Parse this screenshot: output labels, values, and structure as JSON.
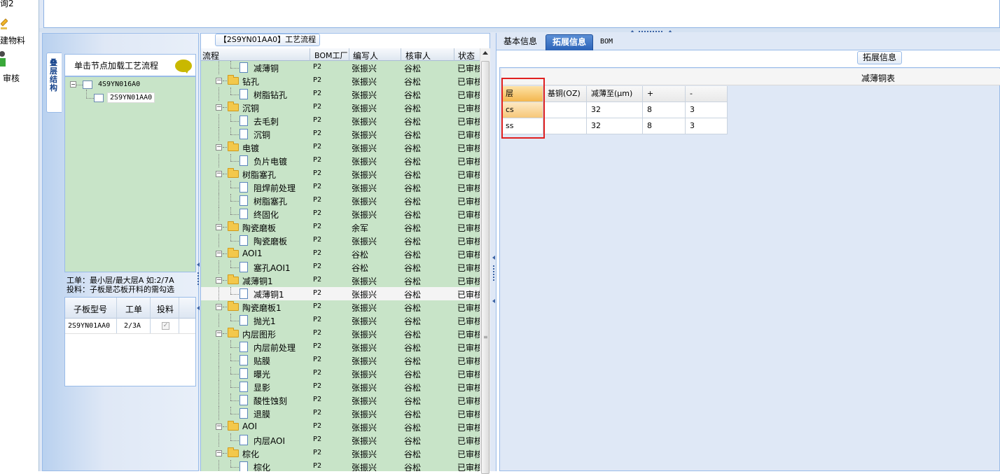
{
  "left_nav": {
    "items": [
      {
        "label": "询2"
      },
      {
        "label": "建物料"
      },
      {
        "label": "审核"
      }
    ]
  },
  "process_panel": {
    "title": "【2S9YN01AA0】工艺流程",
    "columns": [
      "流程",
      "BOM工厂",
      "编写人",
      "核审人",
      "状态"
    ],
    "rows": [
      {
        "name": "减薄铜",
        "level": 1,
        "bom": "P2",
        "author": "张振兴",
        "reviewer": "谷松",
        "status": "已审核"
      },
      {
        "name": "钻孔",
        "level": 0,
        "bom": "P2",
        "author": "张振兴",
        "reviewer": "谷松",
        "status": "已审核"
      },
      {
        "name": "树脂钻孔",
        "level": 1,
        "bom": "P2",
        "author": "张振兴",
        "reviewer": "谷松",
        "status": "已审核"
      },
      {
        "name": "沉铜",
        "level": 0,
        "bom": "P2",
        "author": "张振兴",
        "reviewer": "谷松",
        "status": "已审核"
      },
      {
        "name": "去毛刺",
        "level": 1,
        "bom": "P2",
        "author": "张振兴",
        "reviewer": "谷松",
        "status": "已审核"
      },
      {
        "name": "沉铜",
        "level": 1,
        "bom": "P2",
        "author": "张振兴",
        "reviewer": "谷松",
        "status": "已审核"
      },
      {
        "name": "电镀",
        "level": 0,
        "bom": "P2",
        "author": "张振兴",
        "reviewer": "谷松",
        "status": "已审核"
      },
      {
        "name": "负片电镀",
        "level": 1,
        "bom": "P2",
        "author": "张振兴",
        "reviewer": "谷松",
        "status": "已审核"
      },
      {
        "name": "树脂塞孔",
        "level": 0,
        "bom": "P2",
        "author": "张振兴",
        "reviewer": "谷松",
        "status": "已审核"
      },
      {
        "name": "阻焊前处理",
        "level": 1,
        "bom": "P2",
        "author": "张振兴",
        "reviewer": "谷松",
        "status": "已审核"
      },
      {
        "name": "树脂塞孔",
        "level": 1,
        "bom": "P2",
        "author": "张振兴",
        "reviewer": "谷松",
        "status": "已审核"
      },
      {
        "name": "终固化",
        "level": 1,
        "bom": "P2",
        "author": "张振兴",
        "reviewer": "谷松",
        "status": "已审核"
      },
      {
        "name": "陶瓷磨板",
        "level": 0,
        "bom": "P2",
        "author": "余军",
        "reviewer": "谷松",
        "status": "已审核"
      },
      {
        "name": "陶瓷磨板",
        "level": 1,
        "bom": "P2",
        "author": "张振兴",
        "reviewer": "谷松",
        "status": "已审核"
      },
      {
        "name": "AOI1",
        "level": 0,
        "bom": "P2",
        "author": "谷松",
        "reviewer": "谷松",
        "status": "已审核"
      },
      {
        "name": "塞孔AOI1",
        "level": 1,
        "bom": "P2",
        "author": "谷松",
        "reviewer": "谷松",
        "status": "已审核"
      },
      {
        "name": "减薄铜1",
        "level": 0,
        "bom": "P2",
        "author": "张振兴",
        "reviewer": "谷松",
        "status": "已审核"
      },
      {
        "name": "减薄铜1",
        "level": 1,
        "bom": "P2",
        "author": "张振兴",
        "reviewer": "谷松",
        "status": "已审核",
        "selected": true
      },
      {
        "name": "陶瓷磨板1",
        "level": 0,
        "bom": "P2",
        "author": "张振兴",
        "reviewer": "谷松",
        "status": "已审核"
      },
      {
        "name": "抛光1",
        "level": 1,
        "bom": "P2",
        "author": "张振兴",
        "reviewer": "谷松",
        "status": "已审核"
      },
      {
        "name": "内层图形",
        "level": 0,
        "bom": "P2",
        "author": "张振兴",
        "reviewer": "谷松",
        "status": "已审核"
      },
      {
        "name": "内层前处理",
        "level": 1,
        "bom": "P2",
        "author": "张振兴",
        "reviewer": "谷松",
        "status": "已审核"
      },
      {
        "name": "贴膜",
        "level": 1,
        "bom": "P2",
        "author": "张振兴",
        "reviewer": "谷松",
        "status": "已审核"
      },
      {
        "name": "曝光",
        "level": 1,
        "bom": "P2",
        "author": "张振兴",
        "reviewer": "谷松",
        "status": "已审核"
      },
      {
        "name": "显影",
        "level": 1,
        "bom": "P2",
        "author": "张振兴",
        "reviewer": "谷松",
        "status": "已审核"
      },
      {
        "name": "酸性蚀刻",
        "level": 1,
        "bom": "P2",
        "author": "张振兴",
        "reviewer": "谷松",
        "status": "已审核"
      },
      {
        "name": "退膜",
        "level": 1,
        "bom": "P2",
        "author": "张振兴",
        "reviewer": "谷松",
        "status": "已审核"
      },
      {
        "name": "AOI",
        "level": 0,
        "bom": "P2",
        "author": "张振兴",
        "reviewer": "谷松",
        "status": "已审核"
      },
      {
        "name": "内层AOI",
        "level": 1,
        "bom": "P2",
        "author": "张振兴",
        "reviewer": "谷松",
        "status": "已审核"
      },
      {
        "name": "棕化",
        "level": 0,
        "bom": "P2",
        "author": "张振兴",
        "reviewer": "谷松",
        "status": "已审核"
      },
      {
        "name": "棕化",
        "level": 1,
        "bom": "P2",
        "author": "张振兴",
        "reviewer": "谷松",
        "status": "已审核"
      }
    ]
  },
  "structure_panel": {
    "vertical_tab": "叠层结构",
    "load_hint": "单击节点加载工艺流程",
    "tree": {
      "root": "4S9YN016A0",
      "child": "2S9YN01AA0"
    },
    "note_line1": "工单：最小层/最大层A 如:2/7A",
    "note_line2": "投料：子板是芯板开料的需勾选",
    "sub_grid": {
      "headers": [
        "子板型号",
        "工单",
        "投料"
      ],
      "rows": [
        {
          "model": "2S9YN01AA0",
          "order": "2/3A",
          "feed_checked": true
        }
      ]
    }
  },
  "right_panel": {
    "tabs": [
      {
        "label": "基本信息",
        "active": false
      },
      {
        "label": "拓展信息",
        "active": true
      },
      {
        "label": "BOM",
        "active": false
      }
    ],
    "ext_title": "拓展信息",
    "table_title": "减薄铜表",
    "table": {
      "headers": [
        "层",
        "基铜(OZ)",
        "减薄至(μm)",
        "+",
        "-"
      ],
      "rows": [
        {
          "layer": "cs",
          "base": "",
          "thin": "32",
          "plus": "8",
          "minus": "3"
        },
        {
          "layer": "ss",
          "base": "",
          "thin": "32",
          "plus": "8",
          "minus": "3"
        }
      ]
    }
  }
}
